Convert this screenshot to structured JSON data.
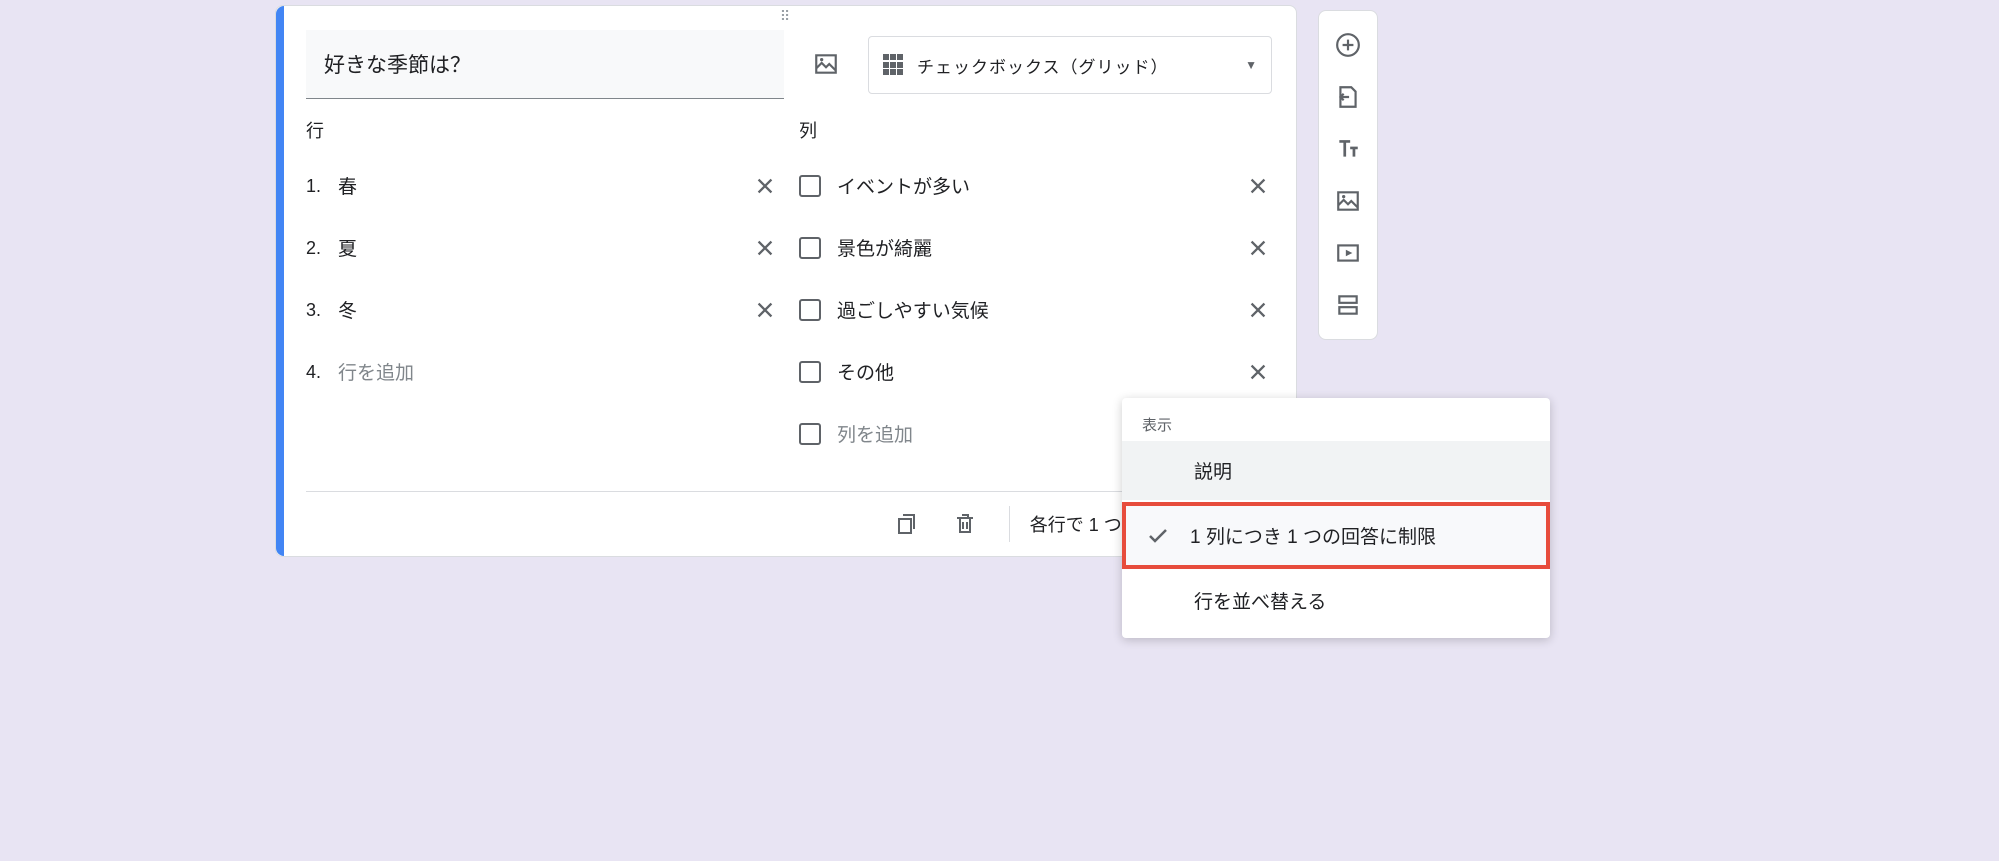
{
  "question": {
    "title": "好きな季節は？",
    "type_label": "チェックボックス（グリッド）"
  },
  "rows": {
    "header": "行",
    "items": [
      {
        "num": "1.",
        "text": "春"
      },
      {
        "num": "2.",
        "text": "夏"
      },
      {
        "num": "3.",
        "text": "冬"
      }
    ],
    "add": {
      "num": "4.",
      "placeholder": "行を追加"
    }
  },
  "columns": {
    "header": "列",
    "items": [
      {
        "text": "イベントが多い"
      },
      {
        "text": "景色が綺麗"
      },
      {
        "text": "過ごしやすい気候"
      },
      {
        "text": "その他"
      }
    ],
    "add_placeholder": "列を追加"
  },
  "footer": {
    "required_label": "各行で 1 つの回答を必須にす"
  },
  "popup": {
    "header": "表示",
    "description": "説明",
    "limit_per_column": "1 列につき 1 つの回答に制限",
    "shuffle_rows": "行を並べ替える"
  }
}
